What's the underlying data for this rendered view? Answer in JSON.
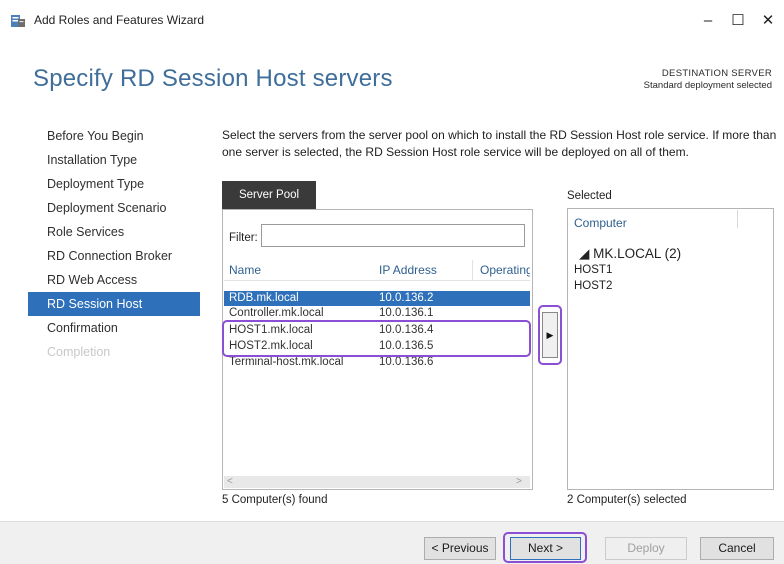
{
  "window": {
    "title": "Add Roles and Features Wizard",
    "icon": "server-manager-icon",
    "controls": [
      "–",
      "☐",
      "✕"
    ]
  },
  "header": {
    "title": "Specify RD Session Host servers",
    "destination_label": "DESTINATION SERVER",
    "destination_value": "Standard deployment selected"
  },
  "nav": {
    "items": [
      {
        "label": "Before You Begin",
        "state": "normal"
      },
      {
        "label": "Installation Type",
        "state": "normal"
      },
      {
        "label": "Deployment Type",
        "state": "normal"
      },
      {
        "label": "Deployment Scenario",
        "state": "normal"
      },
      {
        "label": "Role Services",
        "state": "normal"
      },
      {
        "label": "RD Connection Broker",
        "state": "normal"
      },
      {
        "label": "RD Web Access",
        "state": "normal"
      },
      {
        "label": "RD Session Host",
        "state": "active"
      },
      {
        "label": "Confirmation",
        "state": "normal"
      },
      {
        "label": "Completion",
        "state": "disabled"
      }
    ]
  },
  "main": {
    "description": "Select the servers from the server pool on which to install the RD Session Host role service. If more than one server is selected, the RD Session Host role service will be deployed on all of them.",
    "pool_tab": "Server Pool",
    "filter_label": "Filter:",
    "filter_value": "",
    "columns": [
      "Name",
      "IP Address",
      "Operating"
    ],
    "rows": [
      {
        "name": "RDB.mk.local",
        "ip": "10.0.136.2",
        "selected": true
      },
      {
        "name": "Controller.mk.local",
        "ip": "10.0.136.1",
        "selected": false
      },
      {
        "name": "HOST1.mk.local",
        "ip": "10.0.136.4",
        "selected": false
      },
      {
        "name": "HOST2.mk.local",
        "ip": "10.0.136.5",
        "selected": false
      },
      {
        "name": "Terminal-host.mk.local",
        "ip": "10.0.136.6",
        "selected": false
      }
    ],
    "found_text": "5 Computer(s) found",
    "add_arrow": "▶",
    "scroll_left": "<",
    "scroll_right": ">",
    "selected_label": "Selected",
    "selected_column": "Computer",
    "selected_group": "◢  MK.LOCAL (2)",
    "selected_items": [
      "HOST1",
      "HOST2"
    ],
    "selected_count": "2 Computer(s) selected"
  },
  "footer": {
    "previous": "< Previous",
    "next": "Next >",
    "deploy": "Deploy",
    "cancel": "Cancel"
  },
  "colors": {
    "accent": "#2e70b9",
    "heading": "#3f6e9a",
    "highlight": "#8a4fd4"
  }
}
